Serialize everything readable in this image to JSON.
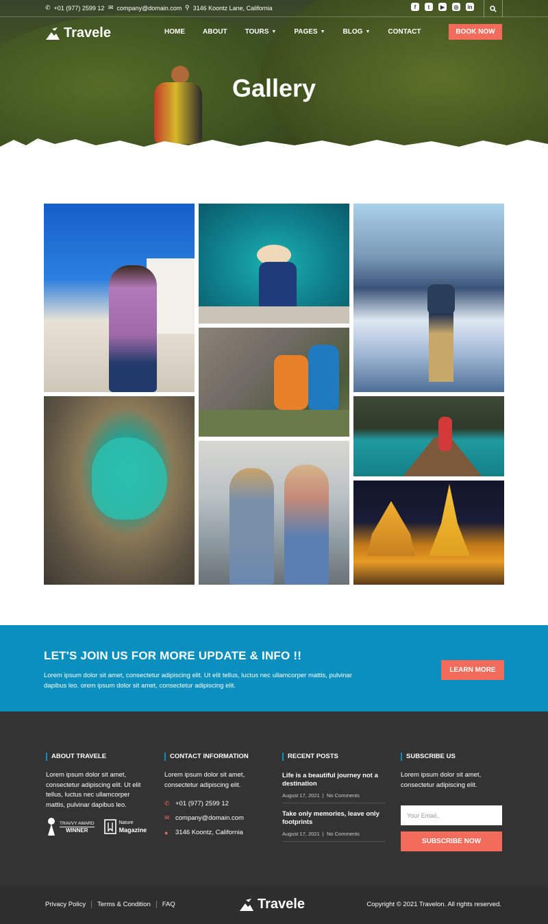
{
  "topbar": {
    "phone": "+01 (977) 2599 12",
    "email": "company@domain.com",
    "address": "3146 Koontz Lane, California",
    "socials": [
      "facebook-icon",
      "twitter-icon",
      "youtube-icon",
      "instagram-icon",
      "linkedin-icon"
    ]
  },
  "nav": {
    "logo": "Travele",
    "items": [
      {
        "label": "HOME",
        "dropdown": false
      },
      {
        "label": "ABOUT",
        "dropdown": false
      },
      {
        "label": "TOURS",
        "dropdown": true
      },
      {
        "label": "PAGES",
        "dropdown": true
      },
      {
        "label": "BLOG",
        "dropdown": true
      },
      {
        "label": "CONTACT",
        "dropdown": false
      }
    ],
    "cta": "BOOK NOW"
  },
  "hero": {
    "title": "Gallery"
  },
  "cta_section": {
    "title": "LET'S JOIN US FOR MORE UPDATE & INFO !!",
    "text": "Lorem ipsum dolor sit amet, consectetur adipiscing elit. Ut elit tellus, luctus nec ullamcorper mattis, pulvinar dapibus leo. orem ipsum dolor sit amet, consectetur adipiscing elit.",
    "button": "LEARN MORE"
  },
  "footer": {
    "about": {
      "heading": "ABOUT TRAVELE",
      "text": "Lorem ipsum dolor sit amet, consectetur adipiscing elit. Ut elit tellus, luctus nec ullamcorper mattis, pulvinar dapibus leo.",
      "badge1_top": "TRAVVY AWARD",
      "badge1_bottom": "WINNER",
      "badge2_top": "Nature",
      "badge2_bottom": "Magazine"
    },
    "contact": {
      "heading": "CONTACT INFORMATION",
      "text": "Lorem ipsum dolor sit amet, consectetur adipiscing elit.",
      "phone": "+01 (977) 2599 12",
      "email": "company@domain.com",
      "address": "3146 Koontz, California"
    },
    "posts": {
      "heading": "RECENT POSTS",
      "items": [
        {
          "title": "Life is a beautiful journey not a destination",
          "date": "August 17, 2021",
          "comments": "No Comments"
        },
        {
          "title": "Take only memories, leave only footprints",
          "date": "August 17, 2021",
          "comments": "No Comments"
        }
      ]
    },
    "subscribe": {
      "heading": "SUBSCRIBE US",
      "text": "Lorem ipsum dolor sit amet, consectetur adipiscing elit.",
      "placeholder": "Your Email..",
      "button": "SUBSCRIBE NOW"
    }
  },
  "bottom": {
    "links": [
      "Privacy Policy",
      "Terms & Condition",
      "FAQ"
    ],
    "logo": "Travele",
    "copyright": "Copyright © 2021 Travelon. All rights reserved."
  },
  "colors": {
    "accent": "#f26b5b",
    "brand_blue": "#0a8fbf",
    "footer_bg": "#333333"
  }
}
